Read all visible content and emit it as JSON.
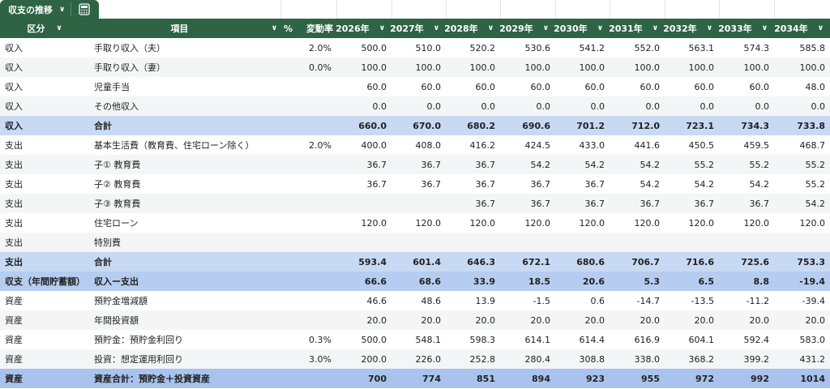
{
  "tab": {
    "label": "収支の推移",
    "chevron": "∨"
  },
  "header": {
    "category": "区分",
    "item": "項目",
    "pct": "%",
    "rate": "変動率",
    "chevron": "∨",
    "years": [
      "2026年",
      "2027年",
      "2028年",
      "2029年",
      "2030年",
      "2031年",
      "2032年",
      "2033年",
      "2034年"
    ]
  },
  "rows": [
    {
      "style": "plain",
      "cat": "収入",
      "item": "手取り収入（夫）",
      "rate": "2.0%",
      "vals": [
        "500.0",
        "510.0",
        "520.2",
        "530.6",
        "541.2",
        "552.0",
        "563.1",
        "574.3",
        "585.8"
      ]
    },
    {
      "style": "alt",
      "cat": "収入",
      "item": "手取り収入（妻）",
      "rate": "0.0%",
      "vals": [
        "100.0",
        "100.0",
        "100.0",
        "100.0",
        "100.0",
        "100.0",
        "100.0",
        "100.0",
        "100.0"
      ]
    },
    {
      "style": "plain",
      "cat": "収入",
      "item": "児童手当",
      "rate": "",
      "vals": [
        "60.0",
        "60.0",
        "60.0",
        "60.0",
        "60.0",
        "60.0",
        "60.0",
        "60.0",
        "48.0"
      ]
    },
    {
      "style": "alt",
      "cat": "収入",
      "item": "その他収入",
      "rate": "",
      "vals": [
        "0.0",
        "0.0",
        "0.0",
        "0.0",
        "0.0",
        "0.0",
        "0.0",
        "0.0",
        "0.0"
      ]
    },
    {
      "style": "total",
      "cat": "収入",
      "item": "合計",
      "rate": "",
      "vals": [
        "660.0",
        "670.0",
        "680.2",
        "690.6",
        "701.2",
        "712.0",
        "723.1",
        "734.3",
        "733.8"
      ]
    },
    {
      "style": "plain",
      "cat": "支出",
      "item": "基本生活費（教育費、住宅ローン除く）",
      "rate": "2.0%",
      "vals": [
        "400.0",
        "408.0",
        "416.2",
        "424.5",
        "433.0",
        "441.6",
        "450.5",
        "459.5",
        "468.7"
      ]
    },
    {
      "style": "alt",
      "cat": "支出",
      "item": "子① 教育費",
      "rate": "",
      "vals": [
        "36.7",
        "36.7",
        "36.7",
        "54.2",
        "54.2",
        "54.2",
        "55.2",
        "55.2",
        "55.2"
      ]
    },
    {
      "style": "plain",
      "cat": "支出",
      "item": "子② 教育費",
      "rate": "",
      "vals": [
        "36.7",
        "36.7",
        "36.7",
        "36.7",
        "36.7",
        "54.2",
        "54.2",
        "54.2",
        "55.2"
      ]
    },
    {
      "style": "alt",
      "cat": "支出",
      "item": "子③ 教育費",
      "rate": "",
      "vals": [
        "",
        "",
        "36.7",
        "36.7",
        "36.7",
        "36.7",
        "36.7",
        "36.7",
        "54.2"
      ]
    },
    {
      "style": "plain",
      "cat": "支出",
      "item": "住宅ローン",
      "rate": "",
      "vals": [
        "120.0",
        "120.0",
        "120.0",
        "120.0",
        "120.0",
        "120.0",
        "120.0",
        "120.0",
        "120.0"
      ]
    },
    {
      "style": "alt",
      "cat": "支出",
      "item": "特別費",
      "rate": "",
      "vals": [
        "",
        "",
        "",
        "",
        "",
        "",
        "",
        "",
        ""
      ]
    },
    {
      "style": "total",
      "cat": "支出",
      "item": "合計",
      "rate": "",
      "vals": [
        "593.4",
        "601.4",
        "646.3",
        "672.1",
        "680.6",
        "706.7",
        "716.6",
        "725.6",
        "753.3"
      ]
    },
    {
      "style": "total2",
      "cat": "収支（年間貯蓄額）",
      "item": "収入ー支出",
      "rate": "",
      "vals": [
        "66.6",
        "68.6",
        "33.9",
        "18.5",
        "20.6",
        "5.3",
        "6.5",
        "8.8",
        "-19.4"
      ]
    },
    {
      "style": "plain",
      "cat": "資産",
      "item": "預貯金増減額",
      "rate": "",
      "vals": [
        "46.6",
        "48.6",
        "13.9",
        "-1.5",
        "0.6",
        "-14.7",
        "-13.5",
        "-11.2",
        "-39.4"
      ]
    },
    {
      "style": "alt",
      "cat": "資産",
      "item": "年間投資額",
      "rate": "",
      "vals": [
        "20.0",
        "20.0",
        "20.0",
        "20.0",
        "20.0",
        "20.0",
        "20.0",
        "20.0",
        "20.0"
      ]
    },
    {
      "style": "plain",
      "cat": "資産",
      "item": "預貯金：預貯金利回り",
      "rate": "0.3%",
      "vals": [
        "500.0",
        "548.1",
        "598.3",
        "614.1",
        "614.4",
        "616.9",
        "604.1",
        "592.4",
        "583.0"
      ]
    },
    {
      "style": "alt",
      "cat": "資産",
      "item": "投資：想定運用利回り",
      "rate": "3.0%",
      "vals": [
        "200.0",
        "226.0",
        "252.8",
        "280.4",
        "308.8",
        "338.0",
        "368.2",
        "399.2",
        "431.2"
      ]
    },
    {
      "style": "total3",
      "cat": "資産",
      "item": "資産合計：預貯金＋投資資産",
      "rate": "",
      "vals": [
        "700",
        "774",
        "851",
        "894",
        "923",
        "955",
        "972",
        "992",
        "1014"
      ]
    }
  ]
}
